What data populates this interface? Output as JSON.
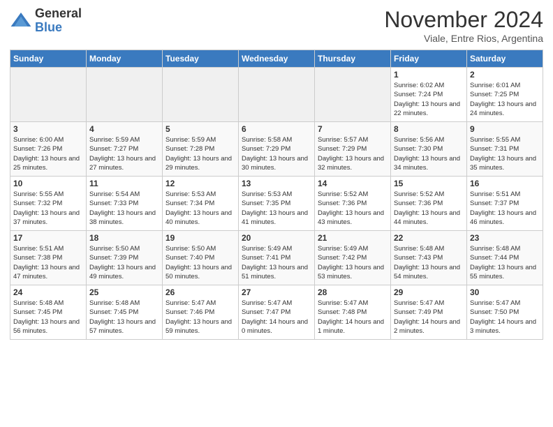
{
  "logo": {
    "text_general": "General",
    "text_blue": "Blue"
  },
  "header": {
    "month": "November 2024",
    "location": "Viale, Entre Rios, Argentina"
  },
  "days_of_week": [
    "Sunday",
    "Monday",
    "Tuesday",
    "Wednesday",
    "Thursday",
    "Friday",
    "Saturday"
  ],
  "weeks": [
    [
      {
        "day": "",
        "info": "",
        "empty": true
      },
      {
        "day": "",
        "info": "",
        "empty": true
      },
      {
        "day": "",
        "info": "",
        "empty": true
      },
      {
        "day": "",
        "info": "",
        "empty": true
      },
      {
        "day": "",
        "info": "",
        "empty": true
      },
      {
        "day": "1",
        "info": "Sunrise: 6:02 AM\nSunset: 7:24 PM\nDaylight: 13 hours\nand 22 minutes.",
        "empty": false
      },
      {
        "day": "2",
        "info": "Sunrise: 6:01 AM\nSunset: 7:25 PM\nDaylight: 13 hours\nand 24 minutes.",
        "empty": false
      }
    ],
    [
      {
        "day": "3",
        "info": "Sunrise: 6:00 AM\nSunset: 7:26 PM\nDaylight: 13 hours\nand 25 minutes.",
        "empty": false
      },
      {
        "day": "4",
        "info": "Sunrise: 5:59 AM\nSunset: 7:27 PM\nDaylight: 13 hours\nand 27 minutes.",
        "empty": false
      },
      {
        "day": "5",
        "info": "Sunrise: 5:59 AM\nSunset: 7:28 PM\nDaylight: 13 hours\nand 29 minutes.",
        "empty": false
      },
      {
        "day": "6",
        "info": "Sunrise: 5:58 AM\nSunset: 7:29 PM\nDaylight: 13 hours\nand 30 minutes.",
        "empty": false
      },
      {
        "day": "7",
        "info": "Sunrise: 5:57 AM\nSunset: 7:29 PM\nDaylight: 13 hours\nand 32 minutes.",
        "empty": false
      },
      {
        "day": "8",
        "info": "Sunrise: 5:56 AM\nSunset: 7:30 PM\nDaylight: 13 hours\nand 34 minutes.",
        "empty": false
      },
      {
        "day": "9",
        "info": "Sunrise: 5:55 AM\nSunset: 7:31 PM\nDaylight: 13 hours\nand 35 minutes.",
        "empty": false
      }
    ],
    [
      {
        "day": "10",
        "info": "Sunrise: 5:55 AM\nSunset: 7:32 PM\nDaylight: 13 hours\nand 37 minutes.",
        "empty": false
      },
      {
        "day": "11",
        "info": "Sunrise: 5:54 AM\nSunset: 7:33 PM\nDaylight: 13 hours\nand 38 minutes.",
        "empty": false
      },
      {
        "day": "12",
        "info": "Sunrise: 5:53 AM\nSunset: 7:34 PM\nDaylight: 13 hours\nand 40 minutes.",
        "empty": false
      },
      {
        "day": "13",
        "info": "Sunrise: 5:53 AM\nSunset: 7:35 PM\nDaylight: 13 hours\nand 41 minutes.",
        "empty": false
      },
      {
        "day": "14",
        "info": "Sunrise: 5:52 AM\nSunset: 7:36 PM\nDaylight: 13 hours\nand 43 minutes.",
        "empty": false
      },
      {
        "day": "15",
        "info": "Sunrise: 5:52 AM\nSunset: 7:36 PM\nDaylight: 13 hours\nand 44 minutes.",
        "empty": false
      },
      {
        "day": "16",
        "info": "Sunrise: 5:51 AM\nSunset: 7:37 PM\nDaylight: 13 hours\nand 46 minutes.",
        "empty": false
      }
    ],
    [
      {
        "day": "17",
        "info": "Sunrise: 5:51 AM\nSunset: 7:38 PM\nDaylight: 13 hours\nand 47 minutes.",
        "empty": false
      },
      {
        "day": "18",
        "info": "Sunrise: 5:50 AM\nSunset: 7:39 PM\nDaylight: 13 hours\nand 49 minutes.",
        "empty": false
      },
      {
        "day": "19",
        "info": "Sunrise: 5:50 AM\nSunset: 7:40 PM\nDaylight: 13 hours\nand 50 minutes.",
        "empty": false
      },
      {
        "day": "20",
        "info": "Sunrise: 5:49 AM\nSunset: 7:41 PM\nDaylight: 13 hours\nand 51 minutes.",
        "empty": false
      },
      {
        "day": "21",
        "info": "Sunrise: 5:49 AM\nSunset: 7:42 PM\nDaylight: 13 hours\nand 53 minutes.",
        "empty": false
      },
      {
        "day": "22",
        "info": "Sunrise: 5:48 AM\nSunset: 7:43 PM\nDaylight: 13 hours\nand 54 minutes.",
        "empty": false
      },
      {
        "day": "23",
        "info": "Sunrise: 5:48 AM\nSunset: 7:44 PM\nDaylight: 13 hours\nand 55 minutes.",
        "empty": false
      }
    ],
    [
      {
        "day": "24",
        "info": "Sunrise: 5:48 AM\nSunset: 7:45 PM\nDaylight: 13 hours\nand 56 minutes.",
        "empty": false
      },
      {
        "day": "25",
        "info": "Sunrise: 5:48 AM\nSunset: 7:45 PM\nDaylight: 13 hours\nand 57 minutes.",
        "empty": false
      },
      {
        "day": "26",
        "info": "Sunrise: 5:47 AM\nSunset: 7:46 PM\nDaylight: 13 hours\nand 59 minutes.",
        "empty": false
      },
      {
        "day": "27",
        "info": "Sunrise: 5:47 AM\nSunset: 7:47 PM\nDaylight: 14 hours\nand 0 minutes.",
        "empty": false
      },
      {
        "day": "28",
        "info": "Sunrise: 5:47 AM\nSunset: 7:48 PM\nDaylight: 14 hours\nand 1 minute.",
        "empty": false
      },
      {
        "day": "29",
        "info": "Sunrise: 5:47 AM\nSunset: 7:49 PM\nDaylight: 14 hours\nand 2 minutes.",
        "empty": false
      },
      {
        "day": "30",
        "info": "Sunrise: 5:47 AM\nSunset: 7:50 PM\nDaylight: 14 hours\nand 3 minutes.",
        "empty": false
      }
    ]
  ]
}
